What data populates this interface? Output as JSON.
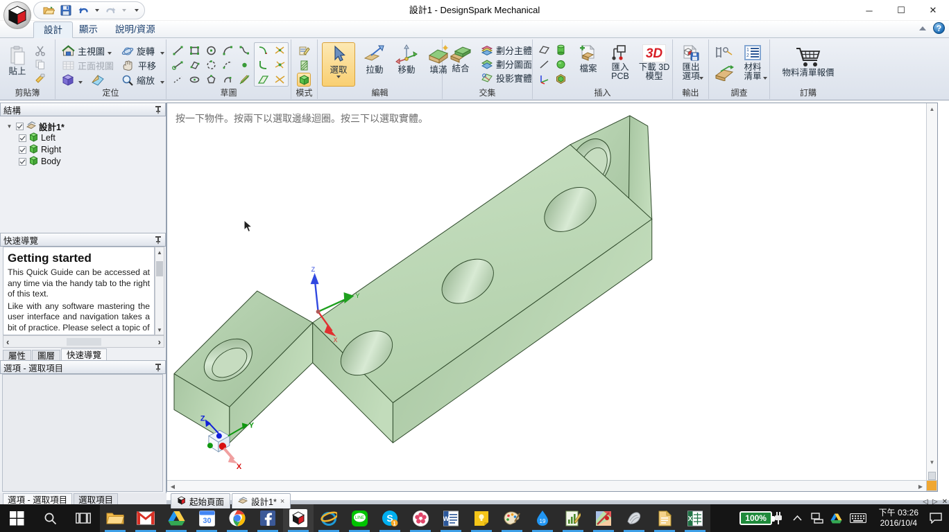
{
  "window": {
    "title": "設計1 - DesignSpark Mechanical",
    "minimize_label": "─",
    "maximize_label": "☐",
    "close_label": "✕"
  },
  "quick_access": {
    "items": [
      {
        "name": "open-icon",
        "label": "開啟"
      },
      {
        "name": "save-icon",
        "label": "儲存"
      },
      {
        "name": "undo-icon",
        "label": "復原"
      },
      {
        "name": "redo-icon",
        "label": "重做"
      },
      {
        "name": "customize-qat-icon",
        "label": "自訂快速存取工具列"
      }
    ]
  },
  "ribbon": {
    "tabs": [
      {
        "label": "設計",
        "active": true
      },
      {
        "label": "顯示",
        "active": false
      },
      {
        "label": "說明/資源",
        "active": false
      }
    ],
    "minimize_ribbon_label": "最小化功能區",
    "help_label": "?",
    "groups": [
      {
        "id": "clipboard",
        "label": "剪貼簿",
        "buttons": [
          {
            "name": "paste-button",
            "label": "貼上"
          },
          {
            "name": "cut-button",
            "label": "剪下"
          },
          {
            "name": "copy-button",
            "label": "複製"
          },
          {
            "name": "format-painter-button",
            "label": "複製格式"
          }
        ]
      },
      {
        "id": "orient",
        "label": "定位",
        "buttons": [
          {
            "name": "home-view-button",
            "label": "主視圖"
          },
          {
            "name": "spin-button",
            "label": "旋轉"
          },
          {
            "name": "front-view-button",
            "label": "正面視圖"
          },
          {
            "name": "pan-button",
            "label": "平移"
          },
          {
            "name": "view-cube-button",
            "label": "視圖"
          },
          {
            "name": "plan-view-button",
            "label": "平面視圖"
          },
          {
            "name": "zoom-button",
            "label": "縮放"
          }
        ]
      },
      {
        "id": "sketch",
        "label": "草圖",
        "tools": [
          "line-tool",
          "rectangle-tool",
          "circle-tool",
          "tangent-arc-tool",
          "spline-tool",
          "construction-line-tool",
          "three-point-rectangle-tool",
          "three-point-arc-tool",
          "sweep-arc-tool",
          "point-tool",
          "dashed-line-tool",
          "ellipse-tool",
          "polygon-tool",
          "corner-arc-tool",
          "sketch-edit-tool"
        ],
        "edit_tools": [
          "trim-tool",
          "split-tool",
          "fillet-tool",
          "project-tool",
          "offset-tool",
          "break-tool"
        ]
      },
      {
        "id": "mode",
        "label": "模式",
        "tools": [
          "sketch-mode-icon",
          "section-mode-icon",
          "solid-mode-icon"
        ]
      },
      {
        "id": "edit",
        "label": "編輯",
        "buttons": [
          {
            "name": "select-button",
            "label": "選取",
            "selected": true
          },
          {
            "name": "pull-button",
            "label": "拉動"
          },
          {
            "name": "move-button",
            "label": "移動"
          },
          {
            "name": "fill-button",
            "label": "填滿"
          }
        ]
      },
      {
        "id": "intersect",
        "label": "交集",
        "buttons": [
          {
            "name": "combine-button",
            "label": "結合"
          },
          {
            "name": "split-body-button",
            "label": "劃分主體"
          },
          {
            "name": "split-face-button",
            "label": "劃分圖面"
          },
          {
            "name": "project-body-button",
            "label": "投影實體"
          }
        ]
      },
      {
        "id": "assemble",
        "label": "插入",
        "tools": [
          "plane-icon",
          "cylinder-icon",
          "axis-icon",
          "sphere-icon",
          "origin-icon",
          "component-icon"
        ],
        "buttons": [
          {
            "name": "insert-file-button",
            "label": "檔案"
          },
          {
            "name": "import-pcb-button",
            "label": "匯入\nPCB"
          },
          {
            "name": "download-3d-model-button",
            "label": "下載 3D\n模型",
            "badge": "3D"
          }
        ]
      },
      {
        "id": "export",
        "label": "輸出",
        "buttons": [
          {
            "name": "export-options-button",
            "label": "匯出\n選項"
          }
        ]
      },
      {
        "id": "survey",
        "label": "調查",
        "buttons": [
          {
            "name": "measure-button",
            "label": "測量"
          },
          {
            "name": "mass-properties-button",
            "label": "質量"
          },
          {
            "name": "bom-button",
            "label": "材料\n清單"
          }
        ]
      },
      {
        "id": "order",
        "label": "訂購",
        "buttons": [
          {
            "name": "bom-quote-button",
            "label": "物料清單報價"
          }
        ]
      }
    ]
  },
  "structure_panel": {
    "title": "結構",
    "pin_label": "自動隱藏",
    "tree": [
      {
        "label": "設計1*",
        "level": 0,
        "checked": true,
        "root": true,
        "icon": "design-icon"
      },
      {
        "label": "Left",
        "level": 1,
        "checked": true,
        "root": false,
        "icon": "body-icon"
      },
      {
        "label": "Right",
        "level": 1,
        "checked": true,
        "root": false,
        "icon": "body-icon"
      },
      {
        "label": "Body",
        "level": 1,
        "checked": true,
        "root": false,
        "icon": "body-icon"
      }
    ]
  },
  "quick_guide_panel": {
    "title": "快速導覽",
    "heading": "Getting started",
    "paragraph1": "This Quick Guide can be accessed at any time via the handy tab to the right of this text.",
    "paragraph2": "Like with any software mastering the user interface and navigation takes a bit of practice. Please select a topic of",
    "prev_label": "‹",
    "next_label": "›",
    "tabs": [
      {
        "label": "屬性",
        "active": false
      },
      {
        "label": "圖層",
        "active": false
      },
      {
        "label": "快速導覽",
        "active": true
      }
    ]
  },
  "options_panel": {
    "title": "選項 - 選取項目",
    "tabs": [
      {
        "label": "選項 - 選取項目",
        "active": true
      },
      {
        "label": "選取項目",
        "active": false
      }
    ]
  },
  "viewport": {
    "hint": "按一下物件。按兩下以選取邊緣迴圈。按三下以選取實體。",
    "model_name": "angle-bracket-3d-model",
    "model_color": "#b9d6b4",
    "axes": [
      {
        "label": "X",
        "color": "#e03030"
      },
      {
        "label": "Y",
        "color": "#1ea01e"
      },
      {
        "label": "Z",
        "color": "#3048e0"
      }
    ],
    "triad_labels": {
      "x": "X",
      "y": "Y",
      "z": "Z"
    }
  },
  "document_tabs": [
    {
      "label": "起始頁面",
      "icon": "home-cube-icon",
      "active": false,
      "closable": false
    },
    {
      "label": "設計1*",
      "icon": "design-icon",
      "active": true,
      "closable": true,
      "close_label": "×"
    }
  ],
  "status_bar": {
    "ghost_text": "按一下物件。按兩下以選取邊緣迴圈。按三下以選取實體。"
  },
  "taskbar": {
    "start_label": "開始",
    "search_label": "搜尋",
    "task_view_label": "工作檢視",
    "apps": [
      {
        "name": "file-explorer-icon",
        "label": "檔案總管",
        "running": true
      },
      {
        "name": "gmail-icon",
        "label": "Gmail",
        "running": true
      },
      {
        "name": "google-drive-icon",
        "label": "Google Drive",
        "running": true
      },
      {
        "name": "google-calendar-icon",
        "label": "Google 日曆",
        "running": true,
        "badge": "30"
      },
      {
        "name": "chrome-icon",
        "label": "Google Chrome",
        "running": true
      },
      {
        "name": "facebook-icon",
        "label": "Facebook",
        "running": true
      },
      {
        "name": "designspark-icon",
        "label": "DesignSpark Mechanical",
        "running": true,
        "active": true
      },
      {
        "name": "internet-explorer-icon",
        "label": "Internet Explorer",
        "running": true
      },
      {
        "name": "line-icon",
        "label": "LINE",
        "running": true
      },
      {
        "name": "skype-icon",
        "label": "Skype",
        "running": true,
        "badge": "1"
      },
      {
        "name": "photo-app-icon",
        "label": "相片",
        "running": true
      },
      {
        "name": "word-icon",
        "label": "Word",
        "running": true
      },
      {
        "name": "notes-icon",
        "label": "便箋",
        "running": true
      },
      {
        "name": "paint-icon",
        "label": "小畫家",
        "running": true
      },
      {
        "name": "water-app-icon",
        "label": "水滴",
        "running": true
      },
      {
        "name": "chart-editor-icon",
        "label": "圖表編輯器",
        "running": true
      },
      {
        "name": "color-picker-icon",
        "label": "色彩工具",
        "running": true
      },
      {
        "name": "sketch-app-icon",
        "label": "繪圖工具",
        "running": true
      },
      {
        "name": "document-icon",
        "label": "文件",
        "running": true
      },
      {
        "name": "excel-icon",
        "label": "Excel",
        "running": true
      }
    ],
    "tray": {
      "battery": "100%",
      "power_label": "電源",
      "show_hidden_label": "顯示隱藏的圖示",
      "network_label": "網路",
      "drive_label": "Google Drive",
      "keyboard_label": "輸入法",
      "time": "下午 03:26",
      "date": "2016/10/4",
      "notification_label": "通知"
    }
  }
}
